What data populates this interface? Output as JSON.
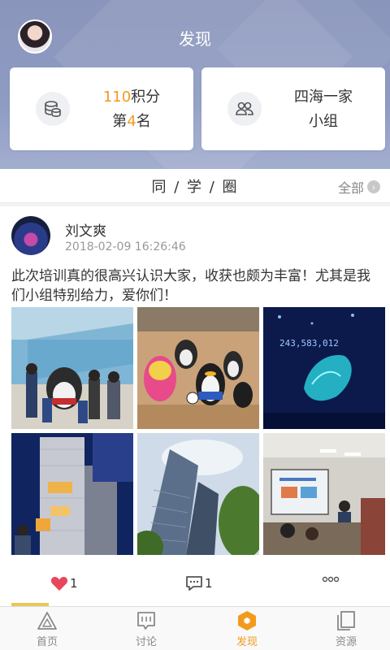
{
  "header": {
    "title": "发现"
  },
  "points_card": {
    "points": "110",
    "points_unit": "积分",
    "rank_prefix": "第",
    "rank": "4",
    "rank_suffix": "名"
  },
  "group_card": {
    "line1": "四海一家",
    "line2": "小组"
  },
  "section": {
    "title": "同 / 学 / 圈",
    "see_all": "全部"
  },
  "post": {
    "author": "刘文爽",
    "time": "2018-02-09 16:26:46",
    "text": "此次培训真的很高兴认识大家，收获也颇为丰富！尤其是我们小组特别给力，爱你们！",
    "photo_overlay_text": "243,583,012",
    "likes": "1",
    "comments": "1"
  },
  "colors": {
    "accent": "#f39a1e",
    "header_bg": "#8e9bc2",
    "like": "#e8475b"
  },
  "tabs": [
    {
      "label": "首页",
      "icon": "home-triangle-icon"
    },
    {
      "label": "讨论",
      "icon": "chat-board-icon"
    },
    {
      "label": "发现",
      "icon": "discover-hexagon-icon"
    },
    {
      "label": "资源",
      "icon": "documents-icon"
    }
  ]
}
